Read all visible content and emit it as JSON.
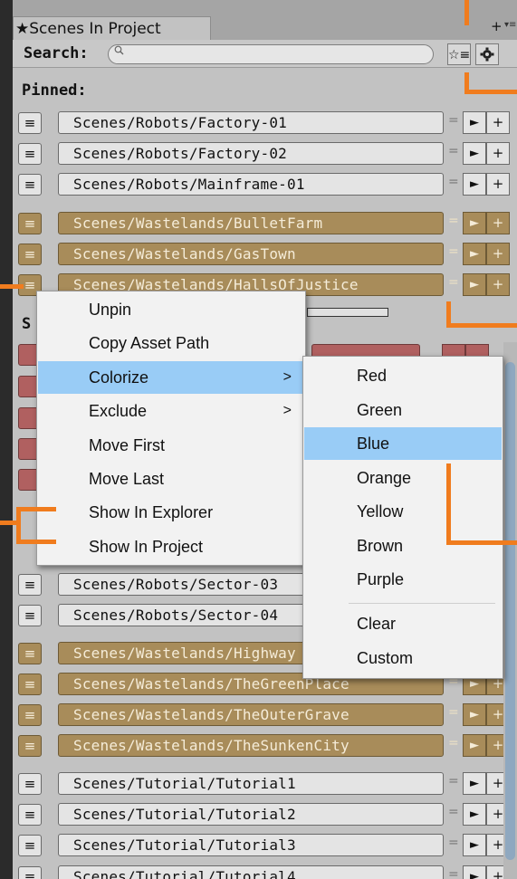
{
  "window": {
    "tab_title": "Scenes In Project",
    "tab_star": "★",
    "corner_plus": "+",
    "corner_menu": "▾≡"
  },
  "toolbar": {
    "search_label": "Search:",
    "search_placeholder": "",
    "search_icon": "search-icon",
    "star_button_glyph": "☆≡",
    "gear_button_glyph": "✱"
  },
  "pinned": {
    "label": "Pinned:",
    "rows": [
      {
        "path": "Scenes/Robots/Factory-01",
        "color": "default"
      },
      {
        "path": "Scenes/Robots/Factory-02",
        "color": "default"
      },
      {
        "path": "Scenes/Robots/Mainframe-01",
        "color": "default"
      },
      {
        "path": "Scenes/Wastelands/BulletFarm",
        "color": "gold"
      },
      {
        "path": "Scenes/Wastelands/GasTown",
        "color": "gold"
      },
      {
        "path": "Scenes/Wastelands/HallsOfJustice",
        "color": "gold"
      }
    ]
  },
  "scenes": {
    "label": "S",
    "rows": [
      {
        "path": "Scenes/Robots/Sector-03",
        "color": "default"
      },
      {
        "path": "Scenes/Robots/Sector-04",
        "color": "default"
      },
      {
        "path": "Scenes/Wastelands/Highway",
        "color": "gold"
      },
      {
        "path": "Scenes/Wastelands/TheGreenPlace",
        "color": "gold"
      },
      {
        "path": "Scenes/Wastelands/TheOuterGrave",
        "color": "gold"
      },
      {
        "path": "Scenes/Wastelands/TheSunkenCity",
        "color": "gold"
      },
      {
        "path": "Scenes/Tutorial/Tutorial1",
        "color": "default"
      },
      {
        "path": "Scenes/Tutorial/Tutorial2",
        "color": "default"
      },
      {
        "path": "Scenes/Tutorial/Tutorial3",
        "color": "default"
      },
      {
        "path": "Scenes/Tutorial/Tutorial4",
        "color": "default"
      }
    ]
  },
  "row_buttons": {
    "menu_glyph": "≡",
    "eq_glyph": "=",
    "play_glyph": "►",
    "plus_glyph": "+"
  },
  "context_menu": {
    "items": [
      {
        "label": "Unpin",
        "submenu": false
      },
      {
        "label": "Copy Asset Path",
        "submenu": false
      },
      {
        "label": "Colorize",
        "submenu": true,
        "highlighted": true
      },
      {
        "label": "Exclude",
        "submenu": true
      },
      {
        "label": "Move First",
        "submenu": false
      },
      {
        "label": "Move Last",
        "submenu": false
      },
      {
        "label": "Show In Explorer",
        "submenu": false
      },
      {
        "label": "Show In Project",
        "submenu": false
      }
    ],
    "submenu_arrow": ">"
  },
  "colorize_submenu": {
    "items": [
      "Red",
      "Green",
      "Blue",
      "Orange",
      "Yellow",
      "Brown",
      "Purple"
    ],
    "extra_items": [
      "Clear",
      "Custom"
    ],
    "highlighted": "Blue"
  },
  "colors": {
    "gold": "#a88c5a",
    "red": "#b06060",
    "highlight": "#99ccf6",
    "callout": "#f07c1e"
  }
}
